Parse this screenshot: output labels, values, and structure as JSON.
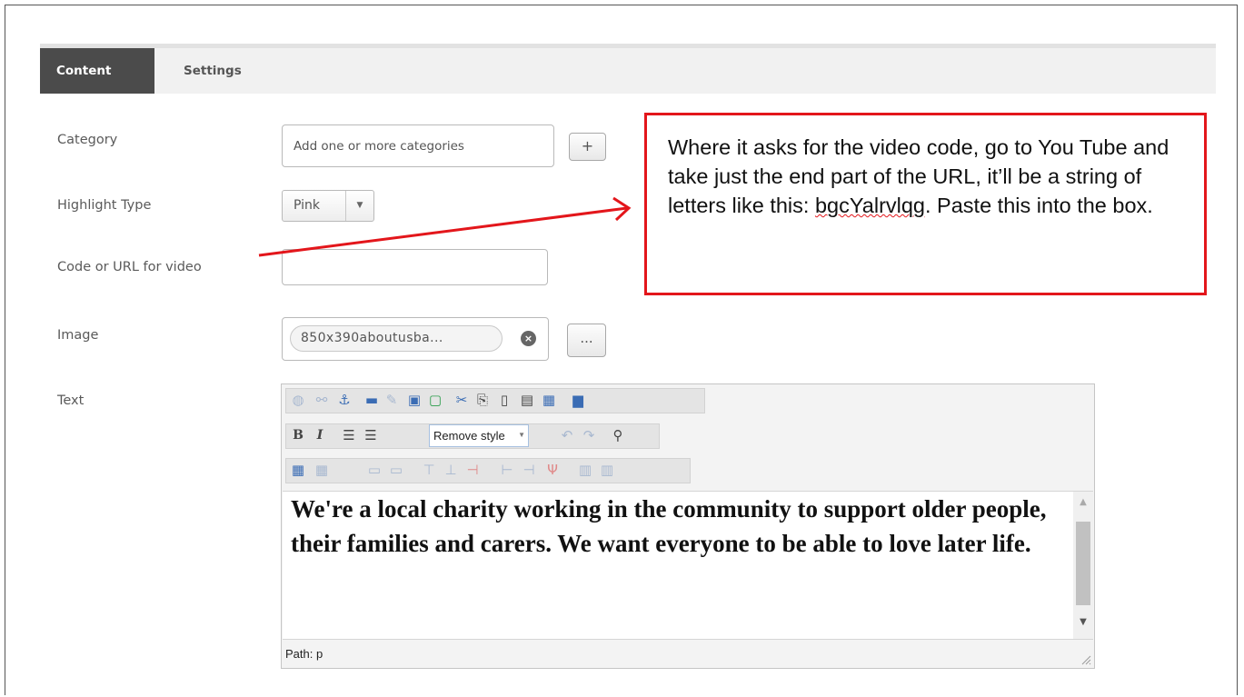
{
  "tabs": [
    {
      "label": "Content",
      "active": true
    },
    {
      "label": "Settings",
      "active": false
    }
  ],
  "form": {
    "category": {
      "label": "Category",
      "placeholder": "Add one or more categories",
      "add_button": "+"
    },
    "highlight": {
      "label": "Highlight Type",
      "value": "Pink"
    },
    "video": {
      "label": "Code or URL for video",
      "value": ""
    },
    "image": {
      "label": "Image",
      "filename": "850x390aboutusba...",
      "clear_icon": "×",
      "browse_button": "..."
    },
    "text": {
      "label": "Text"
    }
  },
  "editor": {
    "style_select": "Remove style",
    "content": "We're a local charity working in the community to support older people, their families and carers. We want everyone to be able to love later life.",
    "path_label": "Path: p",
    "toolbar_icons": {
      "row1": [
        "globe-icon",
        "unlink-icon",
        "anchor-icon",
        "image-icon",
        "edit-image-icon",
        "insert-media-icon",
        "flash-icon",
        "cut-icon",
        "copy-icon",
        "paste-icon",
        "paste-text-icon",
        "paste-word-icon",
        "macro-icon"
      ],
      "row2": [
        "bold-icon",
        "italic-icon",
        "bullet-list-icon",
        "numbered-list-icon",
        "undo-icon",
        "redo-icon",
        "search-icon"
      ],
      "row3": [
        "table-icon",
        "table-props-icon",
        "row-icon",
        "cell-icon",
        "insert-row-before-icon",
        "insert-row-after-icon",
        "delete-row-icon",
        "insert-col-before-icon",
        "insert-col-after-icon",
        "delete-col-icon",
        "merge-cells-icon",
        "split-cells-icon"
      ]
    }
  },
  "callout": {
    "text_before": "Where it asks for the video code, go to You Tube and take just the end part of the URL, it’ll be a string of letters like this: ",
    "code": "bgcYalrvlqg",
    "text_after": ". Paste this into the box.",
    "border_color": "#e3161b"
  }
}
